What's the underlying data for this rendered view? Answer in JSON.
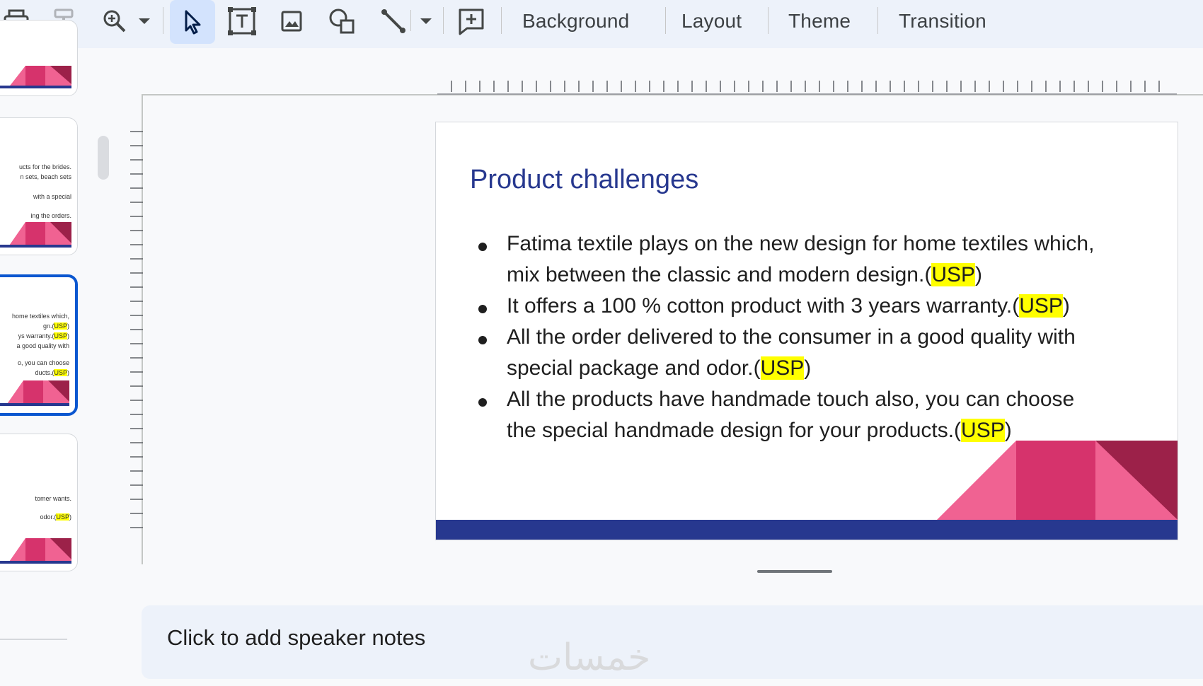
{
  "toolbar": {
    "icons": [
      "print-icon",
      "paint-format-icon",
      "zoom-icon",
      "select-icon",
      "text-box-icon",
      "image-icon",
      "shape-icon",
      "line-icon",
      "comment-icon"
    ],
    "menu_buttons": [
      "Background",
      "Layout",
      "Theme",
      "Transition"
    ]
  },
  "filmstrip": {
    "thumb2_lines": [
      "ucts for the brides.",
      "n sets, beach sets",
      "with a special",
      "ing the orders."
    ],
    "thumb3_lines": [
      "home textiles which,",
      "gn.(",
      "USP",
      ")",
      "ys warranty.(",
      "USP",
      ")",
      "a good quality with",
      "o, you can choose",
      "ducts.(",
      "USP",
      ")"
    ],
    "thumb4_lines": [
      "tomer wants.",
      "odor.(",
      "USP",
      ")"
    ]
  },
  "slide": {
    "title": "Product challenges",
    "bullets": [
      {
        "line1": "Fatima textile plays on the new design for home textiles which,",
        "line2_pre": "mix between the classic and modern design.(",
        "tag": "USP",
        "post": ")"
      },
      {
        "line1_pre": "It offers a 100 % cotton product with 3 years warranty.(",
        "tag": "USP",
        "post": ")"
      },
      {
        "line1": "All the order delivered to the consumer in a good quality with",
        "line2_pre": "special package and odor.(",
        "tag": "USP",
        "post": ")"
      },
      {
        "line1": "All the products have handmade touch also, you can choose",
        "line2_pre": "the special handmade design for your products.(",
        "tag": "USP",
        "post": ")"
      }
    ],
    "colors": {
      "title": "#27388f",
      "band": "#27388f",
      "pink_light": "#f06292",
      "pink_mid": "#d6336c",
      "pink_dark": "#9c2149",
      "highlight": "#ffff00"
    }
  },
  "notes": {
    "placeholder": "Click to add speaker notes"
  },
  "watermark": "خمسات"
}
